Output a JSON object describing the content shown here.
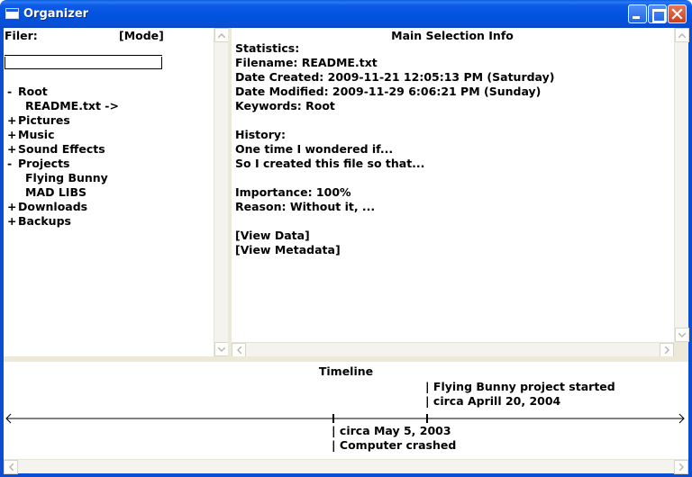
{
  "window": {
    "title": "Organizer"
  },
  "filer": {
    "label": "Filer:",
    "mode": "[Mode]",
    "search_value": "",
    "tree": [
      {
        "prefix": "-",
        "label": "Root",
        "indent": 0
      },
      {
        "prefix": "",
        "label": "README.txt ->",
        "indent": 1
      },
      {
        "prefix": "+",
        "label": "Pictures",
        "indent": 0
      },
      {
        "prefix": "+",
        "label": "Music",
        "indent": 0
      },
      {
        "prefix": "+",
        "label": "Sound Effects",
        "indent": 0
      },
      {
        "prefix": "-",
        "label": "Projects",
        "indent": 0
      },
      {
        "prefix": "",
        "label": "Flying Bunny",
        "indent": 1
      },
      {
        "prefix": "",
        "label": "MAD LIBS",
        "indent": 1
      },
      {
        "prefix": "+",
        "label": "Downloads",
        "indent": 0
      },
      {
        "prefix": "+",
        "label": "Backups",
        "indent": 0
      }
    ]
  },
  "info": {
    "title": "Main Selection Info",
    "lines": [
      "Statistics:",
      "Filename: README.txt",
      "Date Created: 2009-11-21 12:05:13 PM (Saturday)",
      "Date Modified: 2009-11-29 6:06:21 PM (Sunday)",
      "Keywords: Root",
      "",
      "History:",
      "One time I wondered if...",
      "So I created this file so that...",
      "",
      "Importance: 100%",
      "Reason: Without it, ...",
      "",
      "[View Data]",
      "[View Metadata]"
    ]
  },
  "timeline": {
    "title": "Timeline",
    "events": [
      {
        "date": "circa Aprill 20, 2004",
        "description": "Flying Bunny project started",
        "position": "above"
      },
      {
        "date": "circa May 5, 2003",
        "description": "Computer crashed",
        "position": "below"
      }
    ]
  },
  "colors": {
    "titlebar": "#0a52df",
    "chrome": "#ece9d8",
    "close_button": "#c8401e"
  }
}
